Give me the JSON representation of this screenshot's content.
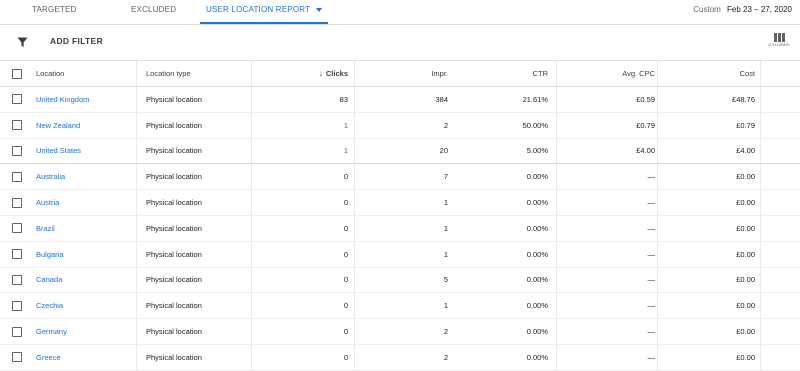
{
  "tabs": [
    {
      "label": "TARGETED"
    },
    {
      "label": "EXCLUDED"
    },
    {
      "label": "USER LOCATION REPORT"
    }
  ],
  "date_range": {
    "label": "Custom",
    "value": "Feb 23 – 27, 2020"
  },
  "toolbar": {
    "add_filter": "ADD FILTER",
    "columns": "COLUMNS"
  },
  "table": {
    "headers": {
      "location": "Location",
      "location_type": "Location type",
      "clicks": "Clicks",
      "impr": "Impr.",
      "ctr": "CTR",
      "avg_cpc": "Avg. CPC",
      "cost": "Cost"
    },
    "sort": {
      "column": "clicks",
      "direction": "descending"
    },
    "rows": [
      {
        "location": "United Kingdom",
        "type": "Physical location",
        "clicks": "83",
        "impr": "384",
        "ctr": "21.61%",
        "cpc": "£0.59",
        "cost": "£48.76"
      },
      {
        "location": "New Zealand",
        "type": "Physical location",
        "clicks": "1",
        "impr": "2",
        "ctr": "50.00%",
        "cpc": "£0.79",
        "cost": "£0.79"
      },
      {
        "location": "United States",
        "type": "Physical location",
        "clicks": "1",
        "impr": "20",
        "ctr": "5.00%",
        "cpc": "£4.00",
        "cost": "£4.00"
      },
      {
        "location": "Australia",
        "type": "Physical location",
        "clicks": "0",
        "impr": "7",
        "ctr": "0.00%",
        "cpc": "—",
        "cost": "£0.00"
      },
      {
        "location": "Austria",
        "type": "Physical location",
        "clicks": "0",
        "impr": "1",
        "ctr": "0.00%",
        "cpc": "—",
        "cost": "£0.00"
      },
      {
        "location": "Brazil",
        "type": "Physical location",
        "clicks": "0",
        "impr": "1",
        "ctr": "0.00%",
        "cpc": "—",
        "cost": "£0.00"
      },
      {
        "location": "Bulgaria",
        "type": "Physical location",
        "clicks": "0",
        "impr": "1",
        "ctr": "0.00%",
        "cpc": "—",
        "cost": "£0.00"
      },
      {
        "location": "Canada",
        "type": "Physical location",
        "clicks": "0",
        "impr": "5",
        "ctr": "0.00%",
        "cpc": "—",
        "cost": "£0.00"
      },
      {
        "location": "Czechia",
        "type": "Physical location",
        "clicks": "0",
        "impr": "1",
        "ctr": "0.00%",
        "cpc": "—",
        "cost": "£0.00"
      },
      {
        "location": "Germany",
        "type": "Physical location",
        "clicks": "0",
        "impr": "2",
        "ctr": "0.00%",
        "cpc": "—",
        "cost": "£0.00"
      },
      {
        "location": "Greece",
        "type": "Physical location",
        "clicks": "0",
        "impr": "2",
        "ctr": "0.00%",
        "cpc": "—",
        "cost": "£0.00"
      }
    ]
  },
  "colors": {
    "accent": "#1a73e8",
    "text": "#202124",
    "muted": "#5f6368"
  }
}
